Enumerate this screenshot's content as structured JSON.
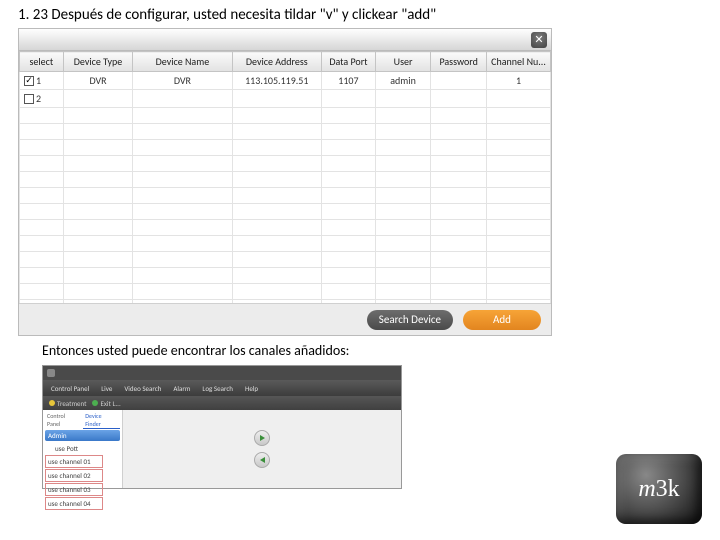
{
  "instruction_top": "1. 23 Después de configurar, usted necesita tildar \"v\" y clickear \"add\"",
  "instruction_bottom": "Entonces usted puede encontrar los canales añadidos:",
  "dialog": {
    "columns": [
      "select",
      "Device Type",
      "Device Name",
      "Device Address",
      "Data Port",
      "User",
      "Password",
      "Channel Nu..."
    ],
    "rows": [
      {
        "checked": true,
        "idx": "1",
        "type": "DVR",
        "name": "DVR",
        "addr": "113.105.119.51",
        "port": "1107",
        "user": "admin",
        "pass": "",
        "chan": "1"
      },
      {
        "checked": false,
        "idx": "2",
        "type": "",
        "name": "",
        "addr": "",
        "port": "",
        "user": "",
        "pass": "",
        "chan": ""
      }
    ],
    "blank_rows": 13,
    "btn_search": "Search Device",
    "btn_add": "Add"
  },
  "app": {
    "nav": [
      "Control Panel",
      "Live",
      "Video Search",
      "Alarm",
      "Log Search",
      "Help"
    ],
    "toolbar": [
      "Treatment",
      "Exit L..."
    ],
    "side_tabs": [
      "Control Panel",
      "Device Finder"
    ],
    "side_header": "Admin",
    "tree": [
      "use Pott",
      "use channel 01",
      "use channel 02",
      "use channel 03",
      "use channel 04"
    ]
  },
  "logo": "m3k"
}
